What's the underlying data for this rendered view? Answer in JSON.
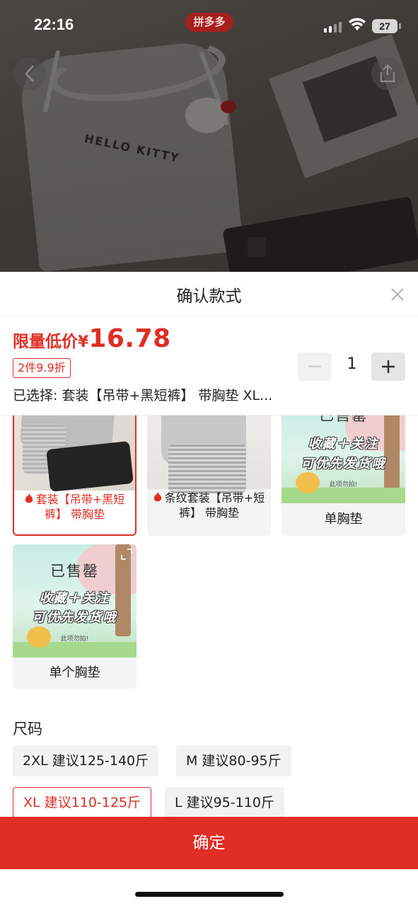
{
  "status_bar": {
    "time": "22:16",
    "app_badge": "拼多多",
    "battery": "27"
  },
  "sheet": {
    "title": "确认款式"
  },
  "price": {
    "label": "限量低价",
    "currency": "¥",
    "value": "16.78"
  },
  "discount_tag": "2件9.9折",
  "quantity": "1",
  "selected_text": "已选择: 套装【吊带+黑短裤】 带胸垫 XL...",
  "options": [
    {
      "label": "套装【吊带+黑短裤】 带胸垫",
      "hot": true,
      "selected": true
    },
    {
      "label": "条纹套装【吊带+短裤】 带胸垫",
      "hot": true,
      "selected": false
    },
    {
      "label": "单胸垫",
      "sold_out": true,
      "selected": false
    },
    {
      "label": "单个胸垫",
      "sold_out": true,
      "selected": false
    }
  ],
  "sold_out_image": {
    "title": "已售罄",
    "line1": "收藏＋关注",
    "line2": "可优先发货哦",
    "note": "此项勿拍!"
  },
  "size_section": {
    "title": "尺码",
    "options": [
      {
        "label": "2XL 建议125-140斤",
        "selected": false
      },
      {
        "label": "M 建议80-95斤",
        "selected": false
      },
      {
        "label": "XL 建议110-125斤",
        "selected": true
      },
      {
        "label": "L 建议95-110斤",
        "selected": false
      }
    ]
  },
  "confirm_button": "确定",
  "colors": {
    "accent": "#e02e24",
    "chip_bg": "#f2f2f2"
  }
}
